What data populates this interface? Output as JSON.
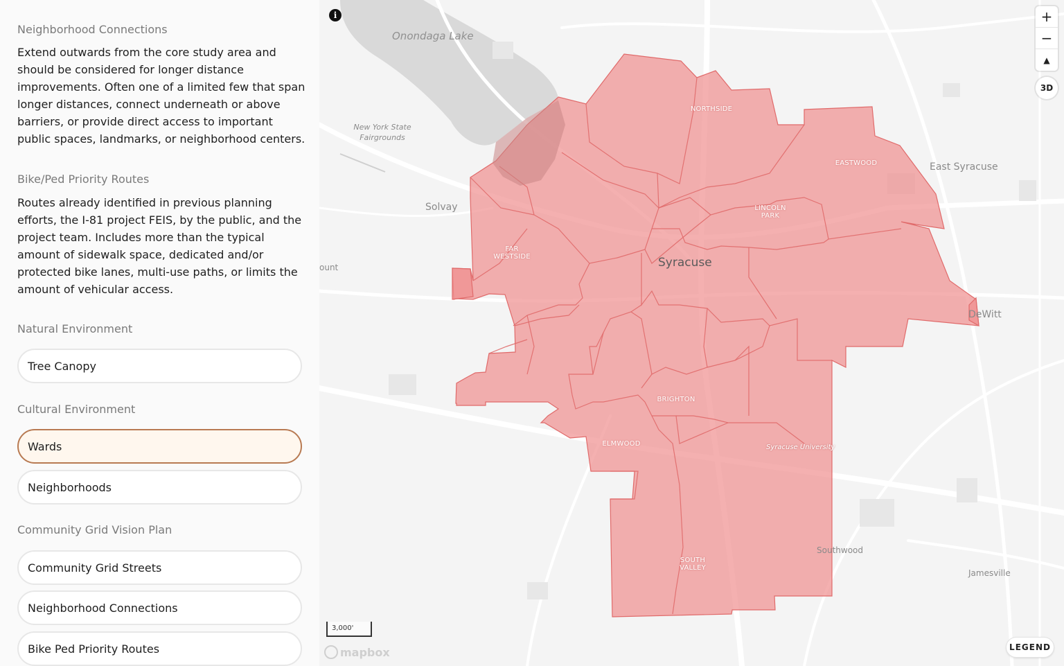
{
  "sidebar": {
    "sections": [
      {
        "heading": "Neighborhood Connections",
        "description": "Extend outwards from the core study area and should be considered for longer distance improvements. Often one of a limited few that span longer distances, connect underneath or above barriers, or provide direct access to important public spaces, landmarks, or neighborhood centers."
      },
      {
        "heading": "Bike/Ped Priority Routes",
        "description": "Routes already identified in previous planning efforts, the I-81 project FEIS, by the public, and the project team. Includes more than the typical amount of sidewalk space, dedicated and/or protected bike lanes, multi-use paths, or limits the amount of vehicular access."
      }
    ],
    "groups": {
      "natural": {
        "heading": "Natural Environment",
        "layers": [
          "Tree Canopy"
        ]
      },
      "cultural": {
        "heading": "Cultural Environment",
        "layers": [
          "Wards",
          "Neighborhoods"
        ],
        "active": "Wards"
      },
      "grid": {
        "heading": "Community Grid Vision Plan",
        "layers": [
          "Community Grid Streets",
          "Neighborhood Connections",
          "Bike Ped Priority Routes"
        ]
      }
    }
  },
  "map": {
    "place_labels": {
      "lake": "Onondaga Lake",
      "fairgrounds": "New York State Fairgrounds",
      "solvay": "Solvay",
      "east_syracuse": "East Syracuse",
      "syracuse": "Syracuse",
      "dewitt": "DeWitt",
      "southwood": "Southwood",
      "jamesville": "Jamesville",
      "ount": "ount",
      "syracuse_university": "Syracuse University"
    },
    "neighborhood_labels": {
      "northside": "NORTHSIDE",
      "eastwood": "EASTWOOD",
      "lincoln_park": "LINCOLN PARK",
      "far_westside": "FAR WESTSIDE",
      "brighton": "BRIGHTON",
      "elmwood": "ELMWOOD",
      "south_valley": "SOUTH VALLEY"
    },
    "controls": {
      "zoom_in": "+",
      "zoom_out": "−",
      "compass": "▲",
      "three_d": "3D",
      "info": "i"
    },
    "scale_label": "3,000'",
    "attribution": "mapbox",
    "legend_label": "LEGEND",
    "ward_fill_color": "#ef8f8f",
    "ward_stroke_color": "#e06a6a"
  }
}
